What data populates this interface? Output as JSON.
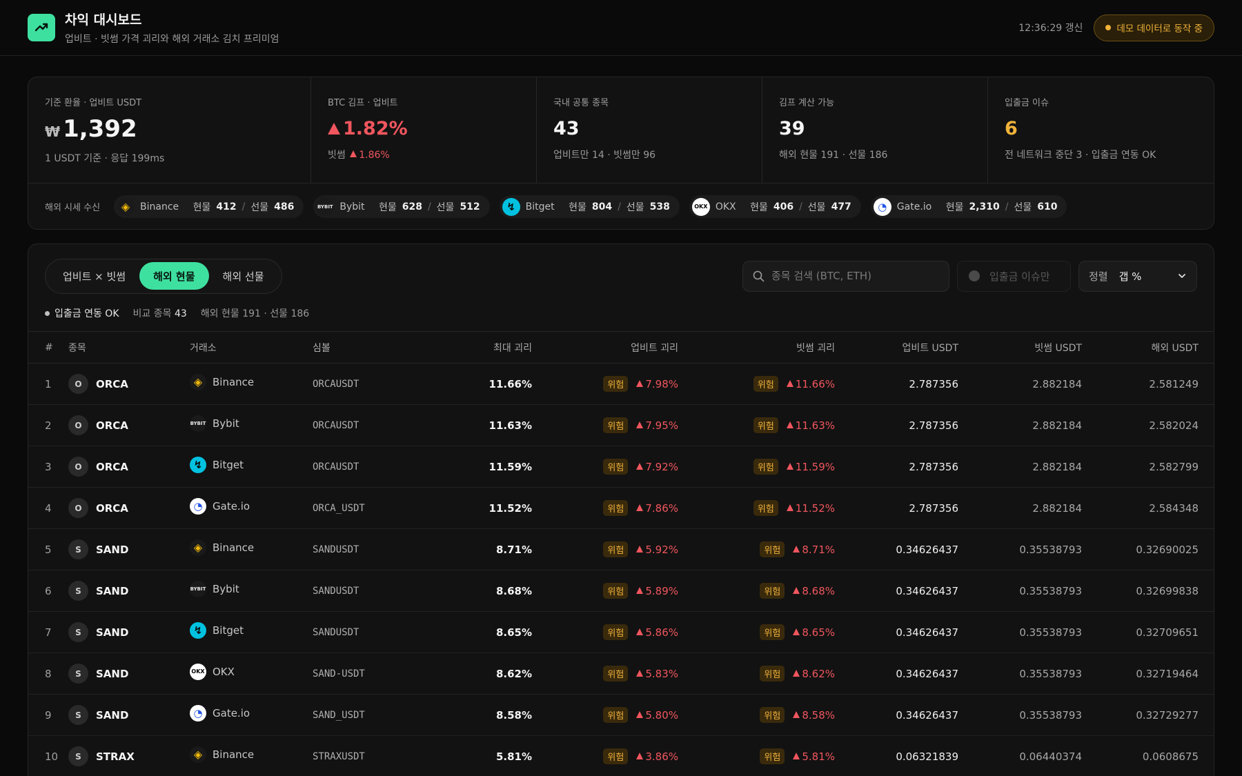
{
  "header": {
    "title": "차익 대시보드",
    "subtitle": "업비트 · 빗썸 가격 괴리와 해외 거래소 김치 프리미엄",
    "updated": "12:36:29 갱신",
    "demo_badge": "데모 데이터로 동작 중"
  },
  "stats": [
    {
      "label": "기준 환율 · 업비트 USDT",
      "currency": "₩",
      "value": "1,392",
      "sub": "1 USDT 기준 · 응답 199ms"
    },
    {
      "label": "BTC 김프 · 업비트",
      "value": "1.82%",
      "sub_prefix": "빗썸",
      "sub_value": "1.86%"
    },
    {
      "label": "국내 공통 종목",
      "value": "43",
      "sub": "업비트만 14 · 빗썸만 96"
    },
    {
      "label": "김프 계산 가능",
      "value": "39",
      "sub": "해외 현물 191 · 선물 186"
    },
    {
      "label": "입출금 이슈",
      "value": "6",
      "sub": "전 네트워크 중단 3 · 입출금 연동 OK"
    }
  ],
  "feed": {
    "label": "해외 시세 수신",
    "spot_label": "현물",
    "futures_label": "선물",
    "sep": "/",
    "exchanges": [
      {
        "name": "Binance",
        "icon": "binance-icon",
        "spot": "412",
        "futures": "486"
      },
      {
        "name": "Bybit",
        "icon": "bybit-icon",
        "spot": "628",
        "futures": "512"
      },
      {
        "name": "Bitget",
        "icon": "bitget-icon",
        "spot": "804",
        "futures": "538"
      },
      {
        "name": "OKX",
        "icon": "okx-icon",
        "spot": "406",
        "futures": "477"
      },
      {
        "name": "Gate.io",
        "icon": "gate-icon",
        "spot": "2,310",
        "futures": "610"
      }
    ]
  },
  "tabs": [
    {
      "label": "업비트 × 빗썸",
      "active": false
    },
    {
      "label": "해외 현물",
      "active": true
    },
    {
      "label": "해외 선물",
      "active": false
    }
  ],
  "search": {
    "placeholder": "종목 검색 (BTC, ETH)"
  },
  "toggle": {
    "label": "입출금 이슈만"
  },
  "sort": {
    "label": "정렬",
    "value": "갭 %"
  },
  "meta": {
    "status": "입출금 연동 OK",
    "compare_label": "비교 종목",
    "compare_count": "43",
    "overseas": "해외 현물 191 · 선물 186"
  },
  "table": {
    "columns": [
      "#",
      "종목",
      "거래소",
      "심볼",
      "최대 괴리",
      "업비트 괴리",
      "빗썸 괴리",
      "업비트 USDT",
      "빗썸 USDT",
      "해외 USDT"
    ],
    "risk_label": "위험",
    "rows": [
      {
        "no": "1",
        "coin": "ORCA",
        "initial": "O",
        "exchange": "Binance",
        "icon": "binance-icon",
        "symbol": "ORCAUSDT",
        "max": "11.66%",
        "upbit_gap": "7.98%",
        "bithumb_gap": "11.66%",
        "upbit_usdt": "2.787356",
        "bithumb_usdt": "2.882184",
        "overseas_usdt": "2.581249"
      },
      {
        "no": "2",
        "coin": "ORCA",
        "initial": "O",
        "exchange": "Bybit",
        "icon": "bybit-icon",
        "symbol": "ORCAUSDT",
        "max": "11.63%",
        "upbit_gap": "7.95%",
        "bithumb_gap": "11.63%",
        "upbit_usdt": "2.787356",
        "bithumb_usdt": "2.882184",
        "overseas_usdt": "2.582024"
      },
      {
        "no": "3",
        "coin": "ORCA",
        "initial": "O",
        "exchange": "Bitget",
        "icon": "bitget-icon",
        "symbol": "ORCAUSDT",
        "max": "11.59%",
        "upbit_gap": "7.92%",
        "bithumb_gap": "11.59%",
        "upbit_usdt": "2.787356",
        "bithumb_usdt": "2.882184",
        "overseas_usdt": "2.582799"
      },
      {
        "no": "4",
        "coin": "ORCA",
        "initial": "O",
        "exchange": "Gate.io",
        "icon": "gate-icon",
        "symbol": "ORCA_USDT",
        "max": "11.52%",
        "upbit_gap": "7.86%",
        "bithumb_gap": "11.52%",
        "upbit_usdt": "2.787356",
        "bithumb_usdt": "2.882184",
        "overseas_usdt": "2.584348"
      },
      {
        "no": "5",
        "coin": "SAND",
        "initial": "S",
        "exchange": "Binance",
        "icon": "binance-icon",
        "symbol": "SANDUSDT",
        "max": "8.71%",
        "upbit_gap": "5.92%",
        "bithumb_gap": "8.71%",
        "upbit_usdt": "0.34626437",
        "bithumb_usdt": "0.35538793",
        "overseas_usdt": "0.32690025"
      },
      {
        "no": "6",
        "coin": "SAND",
        "initial": "S",
        "exchange": "Bybit",
        "icon": "bybit-icon",
        "symbol": "SANDUSDT",
        "max": "8.68%",
        "upbit_gap": "5.89%",
        "bithumb_gap": "8.68%",
        "upbit_usdt": "0.34626437",
        "bithumb_usdt": "0.35538793",
        "overseas_usdt": "0.32699838"
      },
      {
        "no": "7",
        "coin": "SAND",
        "initial": "S",
        "exchange": "Bitget",
        "icon": "bitget-icon",
        "symbol": "SANDUSDT",
        "max": "8.65%",
        "upbit_gap": "5.86%",
        "bithumb_gap": "8.65%",
        "upbit_usdt": "0.34626437",
        "bithumb_usdt": "0.35538793",
        "overseas_usdt": "0.32709651"
      },
      {
        "no": "8",
        "coin": "SAND",
        "initial": "S",
        "exchange": "OKX",
        "icon": "okx-icon",
        "symbol": "SAND-USDT",
        "max": "8.62%",
        "upbit_gap": "5.83%",
        "bithumb_gap": "8.62%",
        "upbit_usdt": "0.34626437",
        "bithumb_usdt": "0.35538793",
        "overseas_usdt": "0.32719464"
      },
      {
        "no": "9",
        "coin": "SAND",
        "initial": "S",
        "exchange": "Gate.io",
        "icon": "gate-icon",
        "symbol": "SAND_USDT",
        "max": "8.58%",
        "upbit_gap": "5.80%",
        "bithumb_gap": "8.58%",
        "upbit_usdt": "0.34626437",
        "bithumb_usdt": "0.35538793",
        "overseas_usdt": "0.32729277"
      },
      {
        "no": "10",
        "coin": "STRAX",
        "initial": "S",
        "exchange": "Binance",
        "icon": "binance-icon",
        "symbol": "STRAXUSDT",
        "max": "5.81%",
        "upbit_gap": "3.86%",
        "bithumb_gap": "5.81%",
        "upbit_usdt": "0.06321839",
        "bithumb_usdt": "0.06440374",
        "overseas_usdt": "0.0608675"
      }
    ]
  },
  "colors": {
    "accent": "#3ee0a0",
    "up": "#f0565e",
    "warn": "#f0b23a",
    "bg": "#0a0a0a"
  }
}
